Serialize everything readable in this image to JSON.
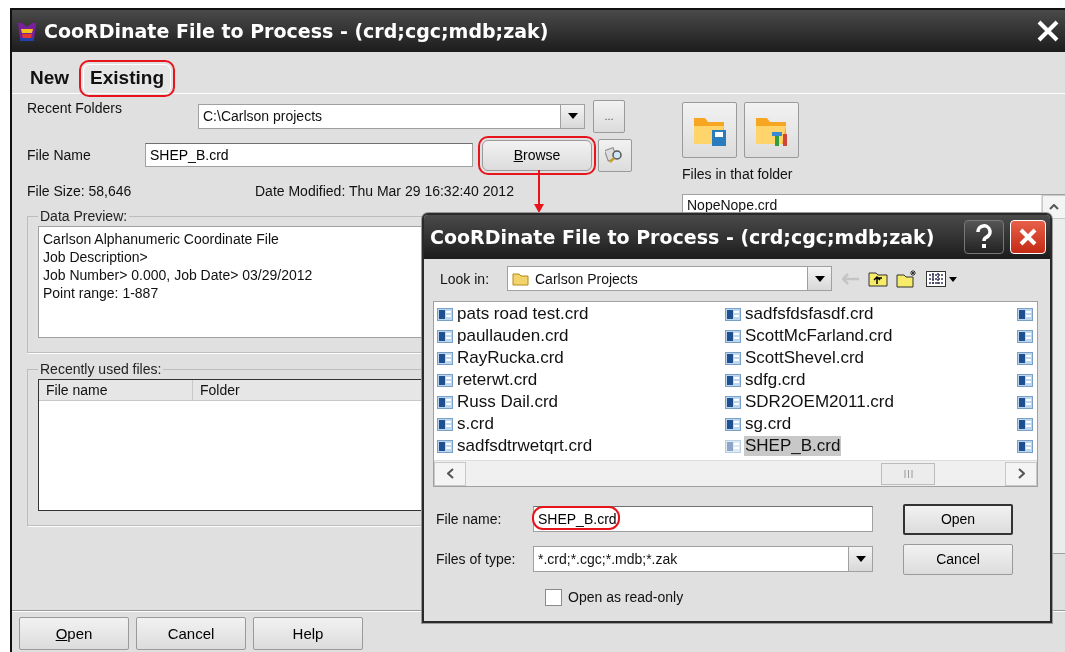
{
  "window": {
    "title": "CooRDinate File to Process - (crd;cgc;mdb;zak)"
  },
  "tabs": [
    {
      "label": "New",
      "selected": false,
      "highlighted": false
    },
    {
      "label": "Existing",
      "selected": true,
      "highlighted": true
    }
  ],
  "recent_folders": {
    "label": "Recent Folders",
    "value": "C:\\Carlson projects",
    "button": "..."
  },
  "file_name": {
    "label": "File Name",
    "value": "SHEP_B.crd"
  },
  "browse_button": {
    "label": "Browse",
    "accelerator": true,
    "highlighted": true
  },
  "file_size": "File Size: 58,646",
  "date_modified": "Date Modified: Thu Mar 29 16:32:40 2012",
  "data_preview": {
    "title": "Data Preview:",
    "lines": [
      "Carlson Alphanumeric Coordinate File",
      "Job Description>",
      "Job Number> 0.000, Job Date> 03/29/2012",
      "Point range: 1-887"
    ]
  },
  "recent_files": {
    "title": "Recently used files:",
    "columns": [
      "File name",
      "Folder"
    ]
  },
  "footer_buttons": [
    {
      "label": "Open",
      "accelerator": true
    },
    {
      "label": "Cancel",
      "accelerator": false
    },
    {
      "label": "Help",
      "accelerator": false
    }
  ],
  "folder_panel": {
    "label": "Files in that folder",
    "files": [
      "NopeNope.crd"
    ]
  },
  "dialog": {
    "title": "CooRDinate File to Process - (crd;cgc;mdb;zak)",
    "look_in": {
      "label": "Look in:",
      "value": "Carlson Projects"
    },
    "files": [
      {
        "name": "pats road test.crd",
        "selected": false
      },
      {
        "name": "paullauden.crd",
        "selected": false
      },
      {
        "name": "RayRucka.crd",
        "selected": false
      },
      {
        "name": "reterwt.crd",
        "selected": false
      },
      {
        "name": "Russ Dail.crd",
        "selected": false
      },
      {
        "name": "s.crd",
        "selected": false
      },
      {
        "name": "sadfsdtrwetqrt.crd",
        "selected": false
      },
      {
        "name": "sadfsfdsfasdf.crd",
        "selected": false
      },
      {
        "name": "ScottMcFarland.crd",
        "selected": false
      },
      {
        "name": "ScottShevel.crd",
        "selected": false
      },
      {
        "name": "sdfg.crd",
        "selected": false
      },
      {
        "name": "SDR2OEM2011.crd",
        "selected": false
      },
      {
        "name": "sg.crd",
        "selected": false
      },
      {
        "name": "SHEP_B.crd",
        "selected": true
      }
    ],
    "file_name": {
      "label": "File name:",
      "value": "SHEP_B.crd",
      "highlighted": true
    },
    "file_type": {
      "label": "Files of type:",
      "value": "*.crd;*.cgc;*.mdb;*.zak"
    },
    "buttons": [
      {
        "label": "Open",
        "default": true
      },
      {
        "label": "Cancel",
        "default": false
      }
    ],
    "read_only": {
      "label": "Open as read-only",
      "checked": false
    }
  }
}
